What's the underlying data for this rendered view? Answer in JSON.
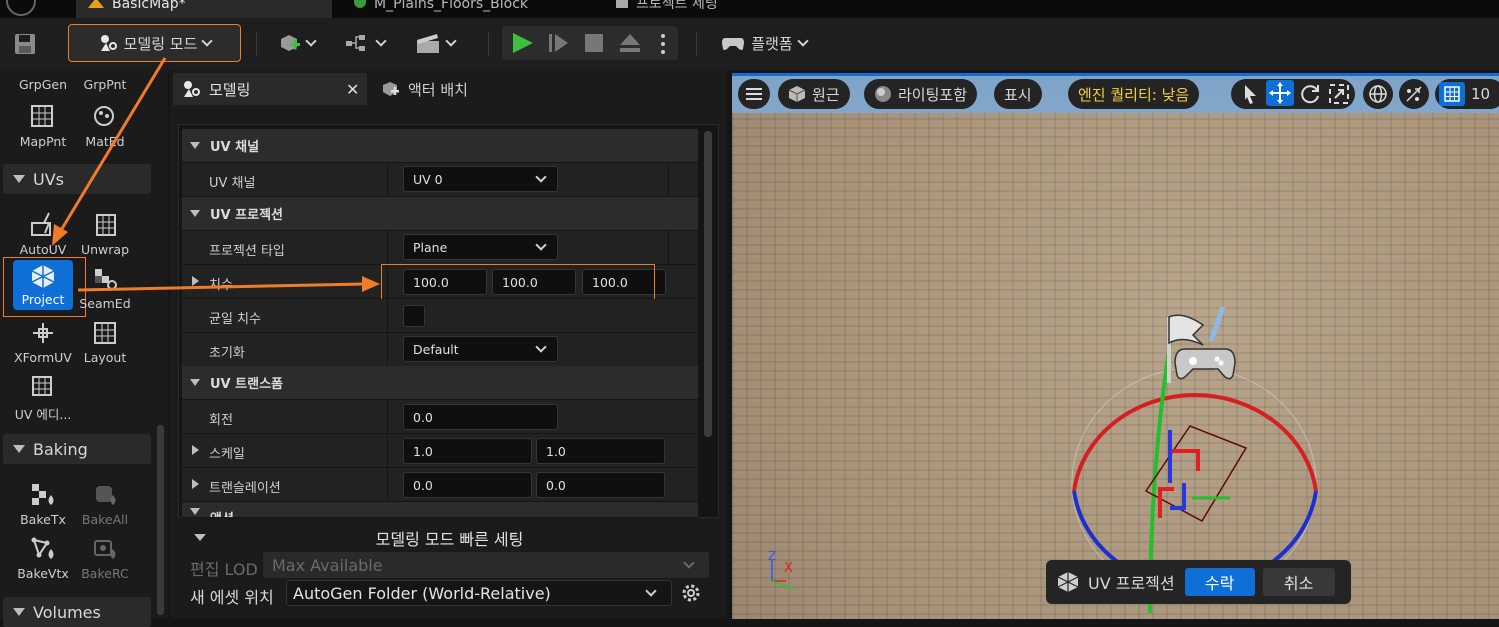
{
  "tabs": [
    {
      "label": "BasicMap*",
      "active": true
    },
    {
      "label": "M_Plains_Floors_Block",
      "active": false
    },
    {
      "label": "프로젝트 세팅",
      "active": false
    }
  ],
  "toolbar": {
    "mode_label": "모델링 모드",
    "platform_label": "플랫폼"
  },
  "left": {
    "top_tools": [
      {
        "label": "GrpGen"
      },
      {
        "label": "GrpPnt"
      },
      {
        "label": "MapPnt"
      },
      {
        "label": "MatEd"
      }
    ],
    "uvs_section": "UVs",
    "uv_tools": [
      {
        "label": "AutoUV"
      },
      {
        "label": "Unwrap"
      },
      {
        "label": "Project"
      },
      {
        "label": "SeamEd"
      },
      {
        "label": "XFormUV"
      },
      {
        "label": "Layout"
      },
      {
        "label": "UV 에디..."
      }
    ],
    "baking_section": "Baking",
    "baking_tools": [
      {
        "label": "BakeTx"
      },
      {
        "label": "BakeAll"
      },
      {
        "label": "BakeVtx"
      },
      {
        "label": "BakeRC"
      }
    ],
    "volumes_section": "Volumes"
  },
  "panel": {
    "tab_modeling": "모델링",
    "tab_actor": "액터 배치",
    "uv_channel_head": "UV 채널",
    "uv_channel_label": "UV 채널",
    "uv_channel_value": "UV 0",
    "projection_head": "UV 프로젝션",
    "projection_type_label": "프로젝션 타입",
    "projection_type_value": "Plane",
    "dimensions_label": "치수",
    "dim_x": "100.0",
    "dim_y": "100.0",
    "dim_z": "100.0",
    "uniform_label": "균일 치수",
    "init_label": "초기화",
    "init_value": "Default",
    "transform_head": "UV 트랜스폼",
    "rotation_label": "회전",
    "rotation_value": "0.0",
    "scale_label": "스케일",
    "scale_x": "1.0",
    "scale_y": "1.0",
    "translation_label": "트랜슬레이션",
    "trans_x": "0.0",
    "trans_y": "0.0",
    "actions_head": "액션"
  },
  "quick": {
    "title": "모델링 모드 빠른 세팅",
    "lod_label": "편집 LOD",
    "lod_value": "Max Available",
    "asset_label": "새 에셋 위치",
    "asset_value": "AutoGen Folder (World-Relative)"
  },
  "viewport": {
    "perspective": "원근",
    "lighting": "라이팅포함",
    "show": "표시",
    "quality": "엔진 퀄리티: 낮음",
    "grid_value": "10",
    "tool_name": "UV 프로젝션",
    "accept": "수락",
    "cancel": "취소",
    "axis_z": "Z",
    "axis_x": "X"
  },
  "colors": {
    "accent": "#0e6fd6",
    "annotation": "#f07c2a",
    "quality_text": "#f0d040"
  }
}
